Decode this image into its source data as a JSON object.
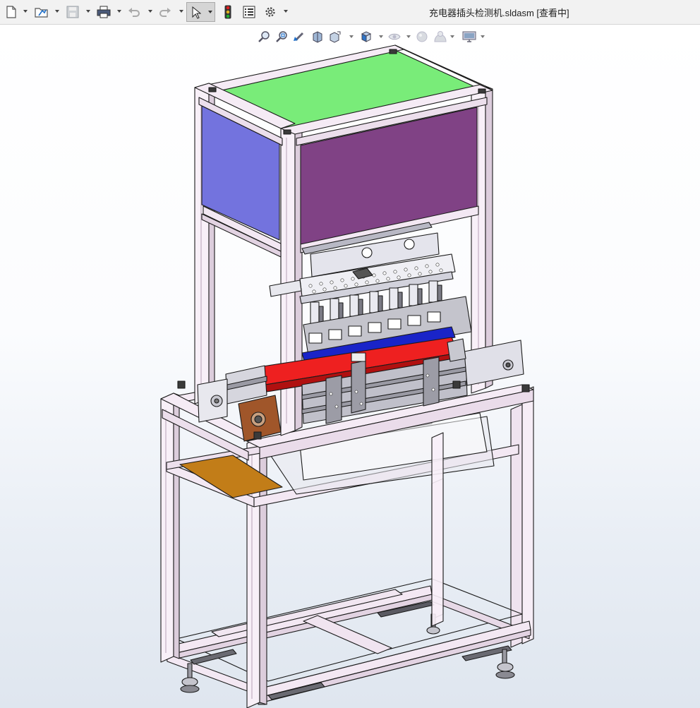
{
  "window": {
    "title": "充电器插头检测机.sldasm [查看中]"
  },
  "toolbar": {
    "buttons": [
      {
        "name": "new-document-icon",
        "label": "New"
      },
      {
        "name": "open-icon",
        "label": "Open"
      },
      {
        "name": "save-icon",
        "label": "Save"
      },
      {
        "name": "print-icon",
        "label": "Print"
      },
      {
        "name": "undo-icon",
        "label": "Undo"
      },
      {
        "name": "redo-icon",
        "label": "Redo"
      },
      {
        "name": "select-icon",
        "label": "Select"
      },
      {
        "name": "traffic-light-icon",
        "label": "Rebuild"
      },
      {
        "name": "file-properties-icon",
        "label": "File Properties"
      },
      {
        "name": "gear-icon",
        "label": "Options"
      }
    ]
  },
  "heads_up_view": {
    "tools": [
      {
        "name": "zoom-to-fit-icon"
      },
      {
        "name": "zoom-to-area-icon"
      },
      {
        "name": "previous-view-icon"
      },
      {
        "name": "section-view-icon"
      },
      {
        "name": "dynamic-annotation-icon"
      },
      {
        "name": "view-orientation-icon"
      },
      {
        "name": "display-style-icon"
      },
      {
        "name": "hide-show-items-icon"
      },
      {
        "name": "edit-appearance-icon"
      },
      {
        "name": "apply-scene-icon"
      },
      {
        "name": "view-settings-icon"
      }
    ]
  },
  "colors": {
    "frame": "#f3e9f3",
    "frame_edge": "#222222",
    "top_panel": "#79ec79",
    "left_panel": "#7373de",
    "front_panel": "#804285",
    "red_bar": "#ee2020",
    "blue_bar": "#1a24c8",
    "brown_plate": "#a0562a",
    "orange_shelf": "#c27d18",
    "gray_plate": "#b8b8c4"
  }
}
